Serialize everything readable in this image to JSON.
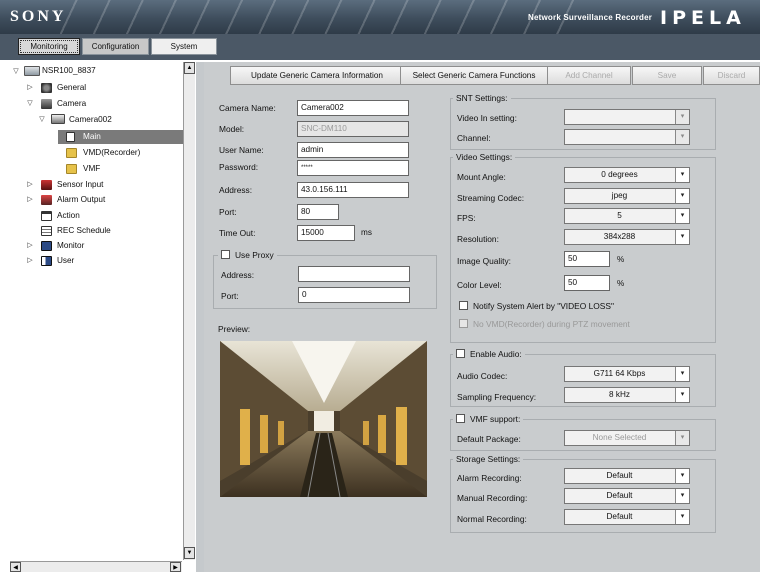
{
  "banner": {
    "brand": "SONY",
    "product": "Network Surveillance Recorder",
    "logo": "IPELA"
  },
  "tabs": [
    {
      "label": "Monitoring"
    },
    {
      "label": "Configuration"
    },
    {
      "label": "System"
    }
  ],
  "tree": [
    {
      "label": "NSR100_8837",
      "icon": "recorder-icon"
    },
    {
      "label": "General",
      "icon": "general-icon"
    },
    {
      "label": "Camera",
      "icon": "camera-icon"
    },
    {
      "label": "Camera002",
      "icon": "camera-device-icon"
    },
    {
      "label": "Main",
      "icon": "page-icon"
    },
    {
      "label": "VMD(Recorder)",
      "icon": "folder-icon"
    },
    {
      "label": "VMF",
      "icon": "folder-icon"
    },
    {
      "label": "Sensor Input",
      "icon": "sensor-icon"
    },
    {
      "label": "Alarm Output",
      "icon": "alarm-icon"
    },
    {
      "label": "Action",
      "icon": "action-icon"
    },
    {
      "label": "REC Schedule",
      "icon": "schedule-icon"
    },
    {
      "label": "Monitor",
      "icon": "monitor-icon"
    },
    {
      "label": "User",
      "icon": "user-icon"
    }
  ],
  "toolbar": {
    "update": "Update Generic Camera Information",
    "select": "Select Generic Camera Functions",
    "add": "Add Channel",
    "save": "Save",
    "discard": "Discard"
  },
  "camera": {
    "name_label": "Camera Name:",
    "name": "Camera002",
    "model_label": "Model:",
    "model": "SNC-DM110",
    "user_label": "User Name:",
    "user": "admin",
    "password_label": "Password:",
    "password": "*****",
    "address_label": "Address:",
    "address": "43.0.156.111",
    "port_label": "Port:",
    "port": "80",
    "timeout_label": "Time Out:",
    "timeout": "15000",
    "timeout_unit": "ms"
  },
  "proxy": {
    "title": "Use Proxy",
    "address_label": "Address:",
    "address": "",
    "port_label": "Port:",
    "port": "0"
  },
  "preview": {
    "label": "Preview:"
  },
  "snt": {
    "title": "SNT Settings:",
    "video_in_label": "Video In setting:",
    "video_in": "",
    "channel_label": "Channel:",
    "channel": ""
  },
  "video": {
    "title": "Video Settings:",
    "mount_label": "Mount Angle:",
    "mount": "0 degrees",
    "codec_label": "Streaming Codec:",
    "codec": "jpeg",
    "fps_label": "FPS:",
    "fps": "5",
    "resolution_label": "Resolution:",
    "resolution": "384x288",
    "quality_label": "Image Quality:",
    "quality": "50",
    "quality_unit": "%",
    "color_label": "Color Level:",
    "color": "50",
    "color_unit": "%",
    "notify_label": "Notify System Alert by \"VIDEO LOSS\"",
    "novmd_label": "No VMD(Recorder) during PTZ movement"
  },
  "audio": {
    "title": "Enable Audio:",
    "codec_label": "Audio Codec:",
    "codec": "G711 64 Kbps",
    "sampling_label": "Sampling Frequency:",
    "sampling": "8 kHz"
  },
  "vmf": {
    "title": "VMF support:",
    "package_label": "Default Package:",
    "package": "None Selected"
  },
  "storage": {
    "title": "Storage Settings:",
    "alarm_label": "Alarm Recording:",
    "alarm": "Default",
    "manual_label": "Manual Recording:",
    "manual": "Default",
    "normal_label": "Normal Recording:",
    "normal": "Default"
  },
  "colors": {
    "banner": "#3e4d5c",
    "panel": "#c9ccce",
    "selection": "#7a7a7a"
  }
}
